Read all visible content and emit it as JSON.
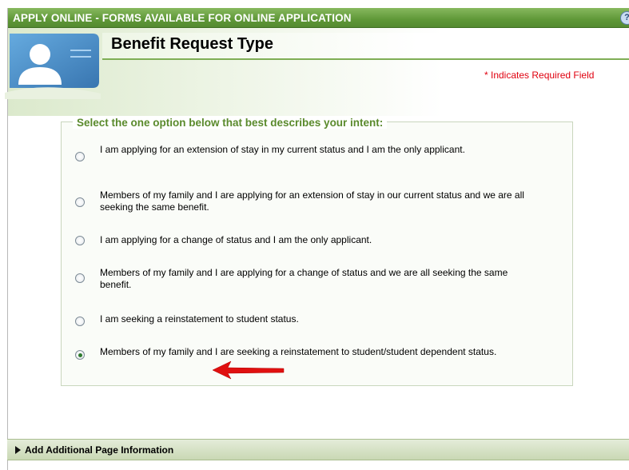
{
  "titlebar": {
    "title": "APPLY ONLINE - FORMS AVAILABLE FOR ONLINE APPLICATION"
  },
  "header": {
    "page_title": "Benefit Request Type",
    "required_note": "* Indicates Required Field"
  },
  "form": {
    "legend": "Select the one option below that best describes your intent:",
    "options": [
      {
        "label": "I am applying for an extension of stay in my current status and I am the only applicant.",
        "selected": false
      },
      {
        "label": "Members of my family and I are applying for an extension of stay in our current status and we are all seeking the same benefit.",
        "selected": false
      },
      {
        "label": "I am applying for a change of status and I am the only applicant.",
        "selected": false
      },
      {
        "label": "Members of my family and I are applying for a change of status and we are all seeking the same benefit.",
        "selected": false
      },
      {
        "label": "I am seeking a reinstatement to student status.",
        "selected": false
      },
      {
        "label": "Members of my family and I are seeking a reinstatement to student/student dependent status.",
        "selected": true
      }
    ]
  },
  "footer": {
    "expand_label": "Add Additional Page Information"
  },
  "icons": {
    "help": "help-icon",
    "avatar": "user-avatar-icon",
    "expand": "triangle-right-icon",
    "annotation": "red-arrow-icon"
  },
  "colors": {
    "title_bar": "#5f9838",
    "legend_text": "#5a8a2c",
    "required": "#e0000f",
    "arrow": "#e01010"
  }
}
